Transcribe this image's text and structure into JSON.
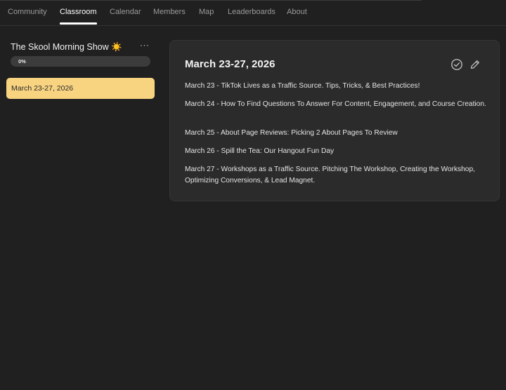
{
  "nav": {
    "tabs": [
      {
        "label": "Community"
      },
      {
        "label": "Classroom"
      },
      {
        "label": "Calendar"
      },
      {
        "label": "Members"
      },
      {
        "label": "Map"
      },
      {
        "label": "Leaderboards"
      },
      {
        "label": "About"
      }
    ],
    "active": "Classroom"
  },
  "sidebar": {
    "course_title": "The Skool Morning Show ☀️",
    "more_label": "···",
    "progress": {
      "label": "0%",
      "value": 0
    },
    "lessons": [
      {
        "label": "March 23-27, 2026",
        "selected": true
      }
    ]
  },
  "lesson": {
    "title": "March 23-27, 2026",
    "icons": [
      "check-circle-icon",
      "pencil-icon"
    ],
    "lines": [
      "March 23 - TikTok Lives as a Traffic Source. Tips, Tricks, & Best Practices!",
      "March 24 - How To Find Questions To Answer For Content, Engagement, and Course Creation.",
      "March 25 - About Page Reviews: Picking 2 About Pages To Review",
      "March 26 - Spill the Tea: Our Hangout Fun Day",
      "March 27 - Workshops as a Traffic Source. Pitching The Workshop, Creating the Workshop, Optimizing Conversions, & Lead Magnet."
    ]
  },
  "colors": {
    "background": "#202020",
    "card": "#2b2b2b",
    "accent": "#f8d481"
  }
}
